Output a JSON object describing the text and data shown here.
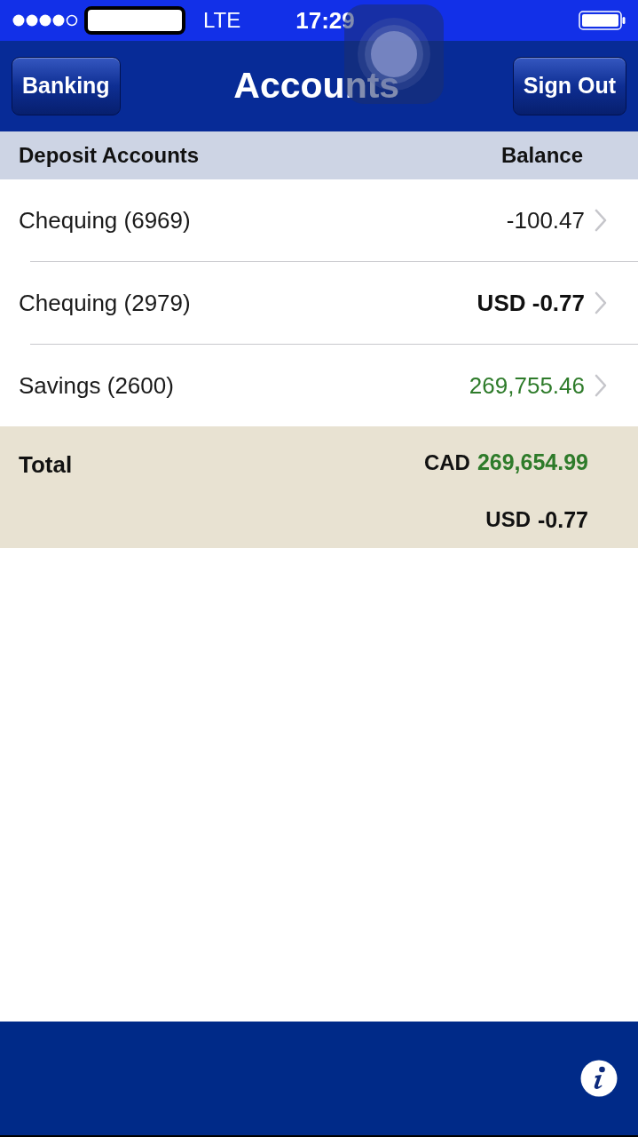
{
  "status_bar": {
    "network": "LTE",
    "time": "17:29"
  },
  "nav_bar": {
    "left_button": "Banking",
    "title": "Accounts",
    "right_button": "Sign Out"
  },
  "table": {
    "columns": [
      "Deposit Accounts",
      "Balance"
    ],
    "rows": [
      {
        "name": "Chequing (6969)",
        "balance": "-100.47",
        "kind": "plain"
      },
      {
        "name": "Chequing (2979)",
        "balance": "USD -0.77",
        "kind": "bold"
      },
      {
        "name": "Savings (2600)",
        "balance": "269,755.46",
        "kind": "positive"
      }
    ]
  },
  "total": {
    "label": "Total",
    "lines": [
      {
        "currency": "CAD",
        "amount": "269,654.99",
        "kind": "positive"
      },
      {
        "currency": "USD",
        "amount": "-0.77",
        "kind": "plain"
      }
    ]
  }
}
